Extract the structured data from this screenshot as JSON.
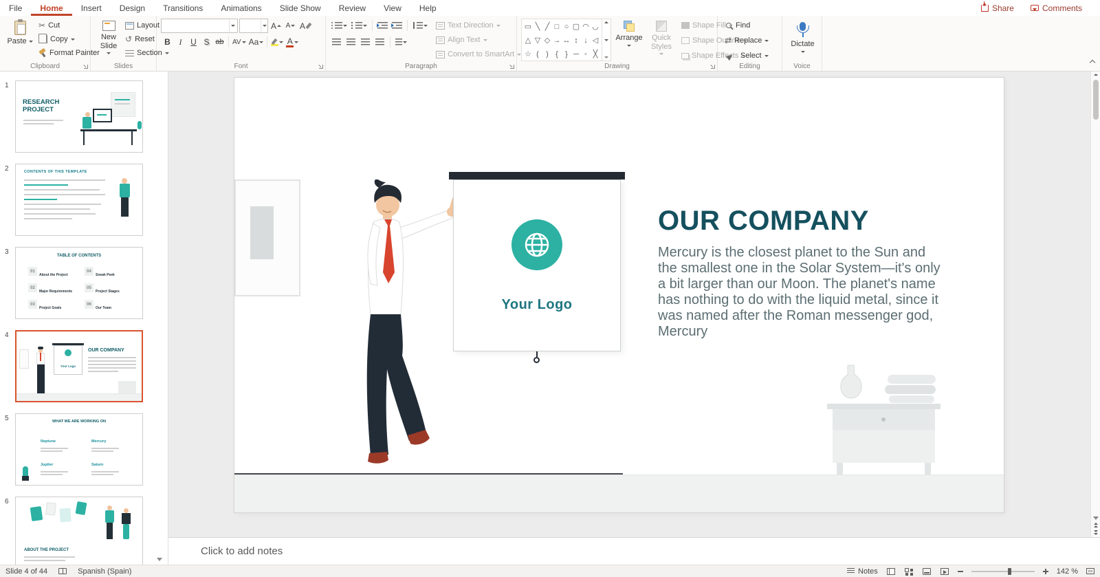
{
  "ribbon": {
    "tabs": [
      "File",
      "Home",
      "Insert",
      "Design",
      "Transitions",
      "Animations",
      "Slide Show",
      "Review",
      "View",
      "Help"
    ],
    "share": "Share",
    "comments": "Comments",
    "clipboard": {
      "label": "Clipboard",
      "paste": "Paste",
      "cut": "Cut",
      "copy": "Copy",
      "format_painter": "Format Painter"
    },
    "slides": {
      "label": "Slides",
      "new_slide": "New Slide",
      "layout": "Layout",
      "reset": "Reset",
      "section": "Section"
    },
    "font": {
      "label": "Font",
      "name_value": "",
      "size_value": "",
      "bold": "B",
      "italic": "I",
      "underline": "U",
      "shadow": "S",
      "strikethrough": "ab",
      "char_spacing": "AV",
      "change_case": "Aa",
      "grow": "A",
      "shrink": "A",
      "clear": "A",
      "font_color": "A"
    },
    "paragraph": {
      "label": "Paragraph",
      "text_direction": "Text Direction",
      "align_text": "Align Text",
      "smartart": "Convert to SmartArt"
    },
    "drawing": {
      "label": "Drawing",
      "arrange": "Arrange",
      "quick_styles": "Quick Styles",
      "shape_fill": "Shape Fill",
      "shape_outline": "Shape Outline",
      "shape_effects": "Shape Effects",
      "gallery": [
        "▭",
        "╲",
        "╱",
        "□",
        "○",
        "▢",
        "◠",
        "◡",
        "△",
        "▽",
        "◇",
        "→",
        "↔",
        "↕",
        "↓",
        "◁",
        "☆",
        "(",
        ")",
        "{",
        "}",
        "─",
        "◦",
        "╳"
      ]
    },
    "editing": {
      "label": "Editing",
      "find": "Find",
      "replace": "Replace",
      "select": "Select"
    },
    "voice": {
      "label": "Voice",
      "dictate": "Dictate"
    },
    "icons": {
      "cut": "✂",
      "reset": "↺",
      "replace": "⇄"
    }
  },
  "thumbnails": {
    "items": [
      {
        "number": "1",
        "title": "RESEARCH PROJECT"
      },
      {
        "number": "2",
        "title": "CONTENTS OF THIS TEMPLATE"
      },
      {
        "number": "3",
        "title": "TABLE OF CONTENTS"
      },
      {
        "number": "4",
        "title": "OUR COMPANY"
      },
      {
        "number": "5",
        "title": "WHAT WE ARE WORKING ON"
      },
      {
        "number": "6",
        "title": "ABOUT THE PROJECT"
      }
    ],
    "thumb3_numbers": [
      "01",
      "02",
      "03",
      "04",
      "05",
      "06"
    ],
    "thumb3_items": [
      "About the Project",
      "Major Requirements",
      "Project Goals",
      "Sneak Peek",
      "Project Stages",
      "Our Team"
    ],
    "thumb5_items": [
      "Neptune",
      "Mercury",
      "Jupiter",
      "Saturn"
    ]
  },
  "slide": {
    "title": "OUR COMPANY",
    "body": "Mercury is the closest planet to the Sun and the smallest one in the Solar System—it's only a bit larger than our Moon. The planet's name has nothing to do with the liquid metal, since it was named after the Roman messenger god, Mercury",
    "logo": "Your Logo"
  },
  "notes": {
    "placeholder": "Click to add notes"
  },
  "status": {
    "slide_indicator": "Slide 4 of 44",
    "language": "Spanish (Spain)",
    "notes_label": "Notes",
    "zoom": "142 %"
  },
  "colors": {
    "accent_red": "#c0442a",
    "selection_orange": "#d9532e",
    "teal": "#2cb1a3",
    "title_teal": "#15505e",
    "body_gray": "#5c6e73"
  }
}
